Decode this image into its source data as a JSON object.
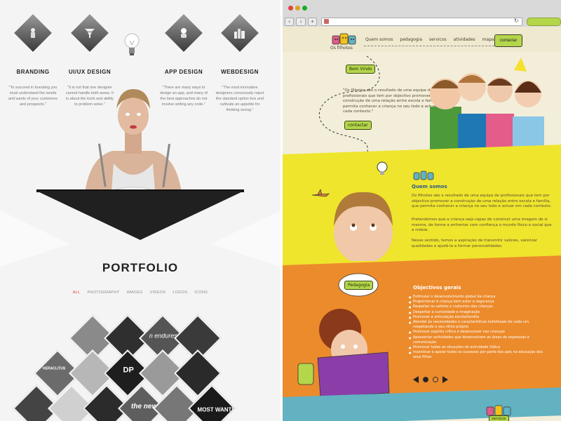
{
  "left": {
    "services": [
      {
        "title": "BRANDING",
        "icon": "person-icon",
        "desc": "\"To succeed in branding you must understand the needs and wants of your customers and prospects.\""
      },
      {
        "title": "UI/UX DESIGN",
        "icon": "tornado-icon",
        "desc": "\"It is not that one designer cannot handle both areas. It is about the tools and ability to problem solve.\""
      },
      {
        "title": "APP DESIGN",
        "icon": "astronaut-icon",
        "desc": "\"There are many ways to design an app, and many of the best approaches do not involve writing any code.\""
      },
      {
        "title": "WEBDESIGN",
        "icon": "city-icon",
        "desc": "\"The most innovative designers consciously reject the standard option box and cultivate an appetite for thinking wrong.\""
      }
    ],
    "portfolio": {
      "title": "PORTFOLIO",
      "filters": [
        "ALL",
        "PHOTOGRAPHY",
        "IMAGES",
        "VIDEOS",
        "LOGOS",
        "ICONS"
      ],
      "active_filter": "ALL",
      "tile_texts": [
        "n endures",
        "the new",
        "MOST WANTED",
        "DP",
        "HERACLITUS"
      ]
    }
  },
  "right": {
    "nav": [
      "Quem somos",
      "pedagogia",
      "servicos",
      "atividades",
      "mapa"
    ],
    "contact_button": "contactar",
    "logo_text": "Os filhotes",
    "welcome": {
      "label": "Bem Vindo",
      "text": "\"Os filhotes são o resultado de uma equipa de profissionais que tem por objectivo promover a construção de uma relação entre escola e família, que permita conhecer a criança no seu todo e actuar em cada contexto.\"",
      "cta": "contactar"
    },
    "about": {
      "title": "Quem somos",
      "paragraphs": [
        "Os filhotes são o resultado de uma equipa de profissionais que tem por objectivo promover a construção de uma relação entre escola e família, que permita conhecer a criança no seu todo e actuar em cada contexto.",
        "Pretendemos que a criança seja capaz de construir uma imagem de si mesma, de forma a enfrentar com confiança o mundo físico e social que a rodeia.",
        "Nesse sentido, temos a aspiração de transmitir valores, valorizar qualidades e ajudá-la a formar personalidades."
      ]
    },
    "pedagogy": {
      "label": "Pedagogia",
      "objectives_title": "Objectivos gerais",
      "objectives": [
        "Estimular o desenvolvimento global da criança",
        "Proporcionar à criança bem estar e segurança",
        "Respeitar os valores e costumes das crianças",
        "Despertar a curiosidade e imaginação",
        "Promover a articulação escola/família",
        "Atender às necessidades e características individuais de cada um, respeitando o seu ritmo próprio",
        "Promover espírito crítico e desenvolver nas crianças",
        "Apresentar actividades que desenvolvam as áreas de expressão e comunicação",
        "Promover todas as situações de actividade lúdica",
        "Incentivar e apoiar todos os sucessos por parte dos pais na educação dos seus filhos"
      ]
    },
    "footer_label": "serviços",
    "colors": {
      "green": "#b4d64b",
      "yellow": "#efe52c",
      "orange": "#ec8b2c",
      "teal": "#62b2c2",
      "cream": "#f3eed9"
    }
  }
}
